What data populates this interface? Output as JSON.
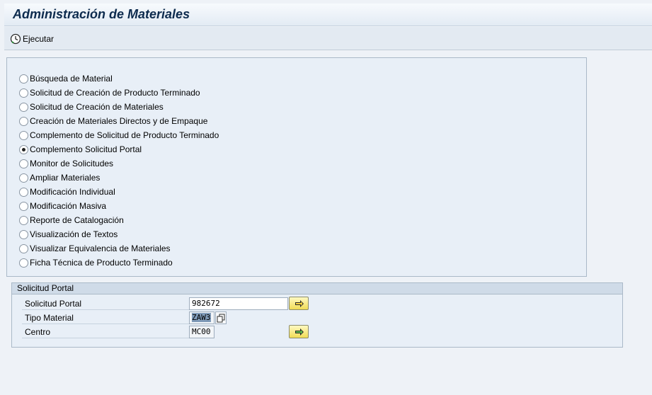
{
  "window": {
    "title": "Administración de Materiales"
  },
  "toolbar": {
    "execute_label": "Ejecutar"
  },
  "options": {
    "items": [
      {
        "label": "Búsqueda de Material",
        "checked": false
      },
      {
        "label": "Solicitud de Creación de Producto Terminado",
        "checked": false
      },
      {
        "label": "Solicitud de Creación de Materiales",
        "checked": false
      },
      {
        "label": "Creación de Materiales Directos y de Empaque",
        "checked": false
      },
      {
        "label": "Complemento de Solicitud de Producto Terminado",
        "checked": false
      },
      {
        "label": "Complemento Solicitud Portal",
        "checked": true
      },
      {
        "label": "Monitor de Solicitudes",
        "checked": false
      },
      {
        "label": "Ampliar Materiales",
        "checked": false
      },
      {
        "label": "Modificación Individual",
        "checked": false
      },
      {
        "label": "Modificación Masiva",
        "checked": false
      },
      {
        "label": "Reporte de Catalogación",
        "checked": false
      },
      {
        "label": "Visualización de Textos",
        "checked": false
      },
      {
        "label": "Visualizar Equivalencia de Materiales",
        "checked": false
      },
      {
        "label": "Ficha Técnica de Producto Terminado",
        "checked": false
      }
    ]
  },
  "solicitud_group": {
    "title": "Solicitud Portal",
    "fields": {
      "solicitud": {
        "label": "Solicitud Portal",
        "value": "982672"
      },
      "tipo": {
        "label": "Tipo Material",
        "value": "ZAW3"
      },
      "centro": {
        "label": "Centro",
        "value": "MC00"
      }
    }
  },
  "icons": {
    "execute": "execute-clock-icon",
    "arrow": "arrow-right-icon",
    "copy": "copy-icon"
  },
  "colors": {
    "title": "#0d2b4e",
    "header_bg": "#cfdbe8",
    "button_yellow": "#f0dc55"
  }
}
